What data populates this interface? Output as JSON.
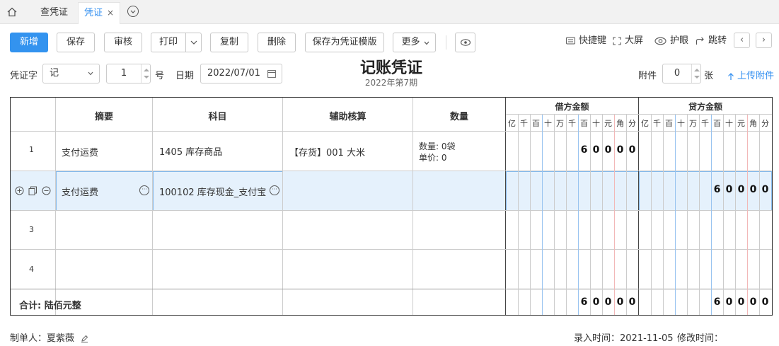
{
  "tabs": {
    "home_icon": "home-icon",
    "items": [
      {
        "label": "查凭证"
      },
      {
        "label": "凭证",
        "close": "×"
      }
    ],
    "more_icon": "chevron-down-circle-icon"
  },
  "toolbar": {
    "new": "新增",
    "save": "保存",
    "review": "审核",
    "print": "打印",
    "copy": "复制",
    "delete": "删除",
    "save_template": "保存为凭证模版",
    "more": "更多",
    "shortcut": "快捷键",
    "fullscreen": "大屏",
    "eye_care": "护眼",
    "jump": "跳转",
    "prev": "‹",
    "next": "›"
  },
  "voucher": {
    "title": "记账凭证",
    "period": "2022年第7期",
    "word_label": "凭证字",
    "word_value": "记",
    "number": "1",
    "number_label": "号",
    "date_label": "日期",
    "date_value": "2022/07/01",
    "attach_label": "附件",
    "attach_value": "0",
    "attach_unit": "张",
    "upload": "上传附件"
  },
  "table": {
    "headers": {
      "summary": "摘要",
      "account": "科目",
      "aux": "辅助核算",
      "qty": "数量",
      "debit": "借方金额",
      "credit": "贷方金额"
    },
    "digits": [
      "亿",
      "千",
      "百",
      "十",
      "万",
      "千",
      "百",
      "十",
      "元",
      "角",
      "分"
    ],
    "rows": [
      {
        "no": "1",
        "summary": "支付运费",
        "account": "1405  库存商品",
        "aux": "【存货】001 大米",
        "qty_line1": "数量: 0袋",
        "qty_line2": "单价: 0",
        "debit": "60000",
        "credit": ""
      },
      {
        "no": "",
        "summary": "支付运费",
        "account": "100102  库存现金_支付宝",
        "aux": "",
        "qty_line1": "",
        "qty_line2": "",
        "debit": "",
        "credit": "60000"
      },
      {
        "no": "3",
        "summary": "",
        "account": "",
        "aux": "",
        "qty_line1": "",
        "qty_line2": "",
        "debit": "",
        "credit": ""
      },
      {
        "no": "4",
        "summary": "",
        "account": "",
        "aux": "",
        "qty_line1": "",
        "qty_line2": "",
        "debit": "",
        "credit": ""
      }
    ],
    "total_label": "合计: 陆佰元整",
    "total_debit": "60000",
    "total_credit": "60000"
  },
  "footer": {
    "maker": "制单人：夏紫薇",
    "entry_time": "录入时间：2021-11-05",
    "modify_time": "修改时间："
  }
}
